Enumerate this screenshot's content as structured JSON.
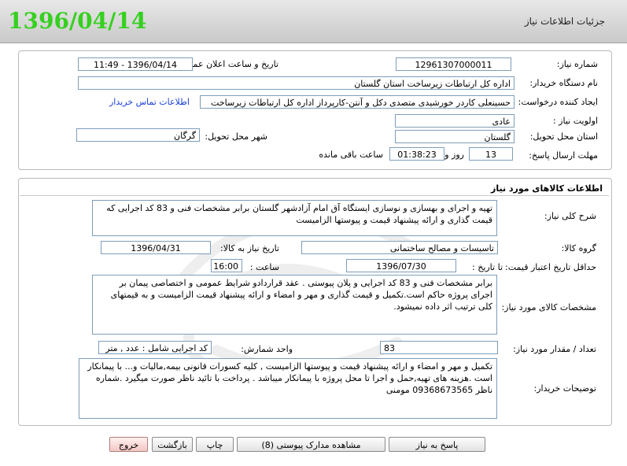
{
  "header": {
    "title": "جزئیات اطلاعات نیاز",
    "date_stamp": "1396/04/14"
  },
  "info": {
    "need_number_label": "شماره نیاز:",
    "need_number": "12961307000011",
    "announce_label": "تاریخ و ساعت اعلان عمومی:",
    "announce_value": "1396/04/14 - 11:49",
    "buyer_label": "نام دستگاه خریدار:",
    "buyer_value": "اداره کل ارتباطات زیرساخت استان گلستان",
    "creator_label": "ایجاد کننده درخواست:",
    "creator_value": "حسینعلی کاردر خورشیدی متصدی دکل و آنتن-کارپرداز اداره کل ارتباطات زیرساخت",
    "contact_link": "اطلاعات تماس خریدار",
    "priority_label": "اولویت نیاز :",
    "priority_value": "عادی",
    "province_label": "استان محل تحویل:",
    "province_value": "گلستان",
    "city_label": "شهر محل تحویل:",
    "city_value": "گرگان",
    "deadline_label": "مهلت ارسال پاسخ:",
    "days_value": "13",
    "days_unit": "روز و",
    "time_value": "01:38:23",
    "time_unit": "ساعت باقی مانده"
  },
  "goods": {
    "section_title": "اطلاعات کالاهای مورد نیاز",
    "general_desc_label": "شرح کلی نیاز:",
    "general_desc": "تهیه و اجرای و بهسازی و نوسازی ایستگاه آق امام آزادشهر گلستان برابر مشخصات فنی و 83 کد اجرایی که قیمت گذاری و ارائه پیشنهاد قیمت و پیوستها الزامیست",
    "group_label": "گروه کالا:",
    "group_value": "تاسیسات و مصالح ساختمانی",
    "need_date_label": "تاریخ نیاز به کالا:",
    "need_date_value": "1396/04/31",
    "min_price_label": "حداقل تاریخ اعتبار قیمت:",
    "until_date_label": "تا تاریخ :",
    "until_date_value": "1396/07/30",
    "hour_label": "ساعت :",
    "hour_value": "16:00",
    "specs_label": "مشخصات کالای مورد نیاز:",
    "specs_value": "برابر مشخصات فنی و 83 کد اجرایی و پلان پیوستی . عقد قراردادو شرایط عمومی و اختصاصی پیمان بر اجرای پروژه حاکم است.تکمیل و قیمت گذاری و مهر و امضاء و ارائه پیشنهاد قیمت الزامیست و به قیمتهای کلی ترتیب اثر داده نمیشود.",
    "qty_label": "تعداد / مقدار مورد نیاز:",
    "qty_value": "83",
    "unit_label": "واحد شمارش:",
    "unit_value": "کد اجرایی شامل : عدد , متر",
    "buyer_notes_label": "توضیحات خریدار:",
    "buyer_notes": "تکمیل و مهر و امضاء و ارائه پیشنهاد قیمت و پیوستها الزامیست , کلیه کسورات قانونی بیمه,مالیات و... با پیمانکار است .هزینه های تهیه,حمل و اجرا تا محل پروژه با پیمانکار میباشد . پرداخت با تائید ناظر صورت میگیرد .شماره ناظر 09368673565 مومنی"
  },
  "buttons": {
    "reply": "پاسخ به نیاز",
    "attachments": "مشاهده مدارک پیوستی (8)",
    "print": "چاپ",
    "back": "بازگشت",
    "exit": "خروج"
  },
  "colors": {
    "stamp": "#35d01f",
    "link": "#1a3fd6",
    "exit_button": "#f3c7c4"
  }
}
